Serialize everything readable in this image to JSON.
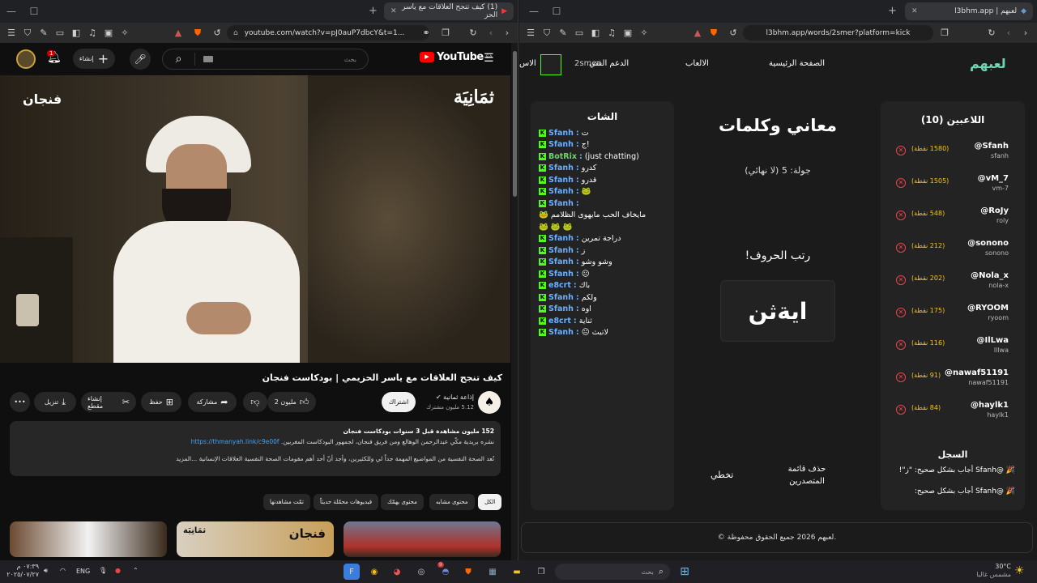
{
  "left_browser": {
    "tab_title": "(1) كيف تنجح العلاقات مع ياسر الحز",
    "url": "youtube.com/watch?v=pJ0auP7dbcY&t=1..."
  },
  "youtube": {
    "logo": "YouTube",
    "region": "SA",
    "search_placeholder": "بحث",
    "create_label": "إنشاء",
    "notif_count": "1",
    "video_overlay_right": "ثمَانِيَة",
    "video_overlay_left": "فنجان",
    "title": "كيف تنجح العلاقات مع ياسر الحزيمي | بودكاست فنجان",
    "channel_name": "إذاعة ثمانية",
    "subscribers": "5.12 مليون مشترك",
    "subscribe": "اشتراك",
    "like_count": "2 مليون",
    "share": "مشاركة",
    "save": "حفظ",
    "clip": "إنشاء مقطع",
    "download": "تنزيل",
    "desc_meta": "152 مليون مشاهدة  قبل 3 سنوات  بودكاست فنجان",
    "desc_line1": "نشره بريدية مكّي عبدالرحمن الوهالع ومن فريق فنجان، لجمهور البودكاست المغربين. ",
    "desc_link": "https://thmanyah.link/c9e00f",
    "desc_line2": "تُعد الصحة النفسية من المواضيع المهمة جداً لي وللكثيرين، وأجد أنّ أحد أهم مقومات الصحة النفسية العلاقات الإنسانية ...المزيد",
    "chips": [
      "الكل",
      "محتوى مشابه",
      "محتوى يهمّك",
      "فيديوهات محمّلة حديثاً",
      "تمّت مشاهدتها"
    ]
  },
  "right_browser": {
    "tab_title": "لعبهم | l3bhm.app",
    "url": "l3bhm.app/words/2smer?platform=kick"
  },
  "site": {
    "logo": "لعبهم",
    "nav": [
      "الصفحة الرئيسية",
      "الالعاب",
      "الدعم الفني"
    ],
    "username": "2smer",
    "nav_cut": "الاس",
    "players_title": "اللاعبين (10)",
    "players": [
      {
        "name": "@Sfanh",
        "sub": "sfanh",
        "points": "(1580 نقطة)"
      },
      {
        "name": "@vM_7",
        "sub": "vm-7",
        "points": "(1505 نقطة)"
      },
      {
        "name": "@RoJy",
        "sub": "roly",
        "points": "(548 نقطة)"
      },
      {
        "name": "@sonono",
        "sub": "sonono",
        "points": "(212 نقطة)"
      },
      {
        "name": "@Nola_x",
        "sub": "nola-x",
        "points": "(202 نقطة)"
      },
      {
        "name": "@RYOOM",
        "sub": "ryoom",
        "points": "(175 نقطة)"
      },
      {
        "name": "@IlLwa",
        "sub": "lllwa",
        "points": "(116 نقطة)"
      },
      {
        "name": "@nawaf51191",
        "sub": "nawaf51191",
        "points": "(91 نقطة)"
      },
      {
        "name": "@haylk1",
        "sub": "haylk1",
        "points": "(84 نقطة)"
      }
    ],
    "log_title": "السجل",
    "log": [
      "@Sfanh أجاب بشكل صحيح: \"ز\"!",
      "@Sfanh أجاب بشكل صحيح:"
    ],
    "game_title": "معاني وكلمات",
    "round": "جولة: 5 (لا نهائي)",
    "instruction": "رتب الحروف!",
    "letters": "ايةثن",
    "skip": "تخطي",
    "clear_board": "حذف قائمة المتصدرين",
    "chat_title": "الشات",
    "chat": [
      {
        "nick": "Sfanh",
        "msg": "ت",
        "type": "user"
      },
      {
        "nick": "Sfanh",
        "msg": "!ج",
        "type": "user"
      },
      {
        "nick": "BotRix",
        "msg": "(just chatting)",
        "type": "bot"
      },
      {
        "nick": "Sfanh",
        "msg": "كدرو",
        "type": "user"
      },
      {
        "nick": "Sfanh",
        "msg": "قدرو",
        "type": "user"
      },
      {
        "nick": "Sfanh",
        "msg": "🐸",
        "type": "user"
      },
      {
        "nick": "Sfanh",
        "msg": "",
        "type": "user"
      },
      {
        "nick": "",
        "msg": "مايخاف الحب مايهوى الظلامم 🐸",
        "type": "plain"
      },
      {
        "nick": "",
        "msg": "🐸 🐸 🐸",
        "type": "plain"
      },
      {
        "nick": "Sfanh",
        "msg": "دراجة تمرين",
        "type": "user"
      },
      {
        "nick": "Sfanh",
        "msg": "ز",
        "type": "user"
      },
      {
        "nick": "Sfanh",
        "msg": "وشو وشو",
        "type": "user"
      },
      {
        "nick": "Sfanh",
        "msg": "😐",
        "type": "user"
      },
      {
        "nick": "e8crt",
        "msg": "باك",
        "type": "user"
      },
      {
        "nick": "Sfanh",
        "msg": "ولكم",
        "type": "user"
      },
      {
        "nick": "Sfanh",
        "msg": "اوه",
        "type": "user"
      },
      {
        "nick": "e8crt",
        "msg": "ثناية",
        "type": "user"
      },
      {
        "nick": "Sfanh",
        "msg": "لاتبث 😐",
        "type": "user"
      }
    ],
    "footer": "© لعبهم 2026 جميع الحقوق محفوظة."
  },
  "taskbar": {
    "search_placeholder": "بحث",
    "lang": "ENG",
    "time": "٠٧:٣٩ م",
    "date": "٢٠٢٥/٠٧/٢٧",
    "weather_temp": "30°C",
    "weather_desc": "مشمس غالبا",
    "badge": "9"
  },
  "colors": {
    "kick_green": "#53fc18",
    "yt_red": "#ff0000",
    "points_gold": "#f5c518",
    "remove_red": "#e24a4a"
  }
}
